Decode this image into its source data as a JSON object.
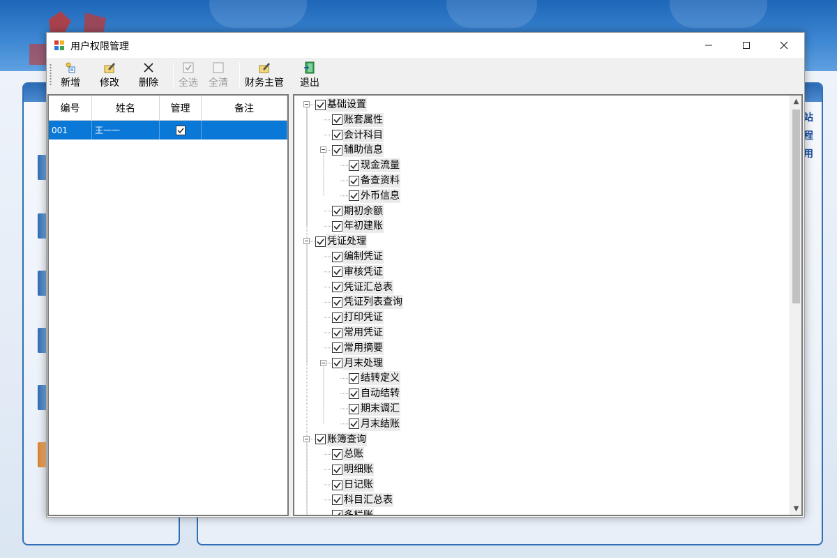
{
  "window": {
    "title": "用户权限管理",
    "controls": {
      "minimize": "─",
      "maximize": "☐",
      "close": "✕"
    }
  },
  "toolbar": {
    "add": "新增",
    "edit": "修改",
    "delete": "删除",
    "select_all": "全选",
    "clear_all": "全清",
    "finance_supervisor": "财务主管",
    "exit": "退出"
  },
  "users_grid": {
    "columns": [
      "编号",
      "姓名",
      "管理",
      "备注"
    ],
    "rows": [
      {
        "id": "001",
        "name": "王一一",
        "is_admin": true,
        "note": ""
      }
    ]
  },
  "permissions_tree": [
    {
      "label": "基础设置",
      "checked": true
    },
    {
      "label": "账套属性",
      "checked": true
    },
    {
      "label": "会计科目",
      "checked": true
    },
    {
      "label": "辅助信息",
      "checked": true
    },
    {
      "label": "现金流量",
      "checked": true
    },
    {
      "label": "备查资料",
      "checked": true
    },
    {
      "label": "外币信息",
      "checked": true
    },
    {
      "label": "期初余额",
      "checked": true
    },
    {
      "label": "年初建账",
      "checked": true
    },
    {
      "label": "凭证处理",
      "checked": true
    },
    {
      "label": "编制凭证",
      "checked": true
    },
    {
      "label": "审核凭证",
      "checked": true
    },
    {
      "label": "凭证汇总表",
      "checked": true
    },
    {
      "label": "凭证列表查询",
      "checked": true
    },
    {
      "label": "打印凭证",
      "checked": true
    },
    {
      "label": "常用凭证",
      "checked": true
    },
    {
      "label": "常用摘要",
      "checked": true
    },
    {
      "label": "月末处理",
      "checked": true
    },
    {
      "label": "结转定义",
      "checked": true
    },
    {
      "label": "自动结转",
      "checked": true
    },
    {
      "label": "期末调汇",
      "checked": true
    },
    {
      "label": "月末结账",
      "checked": true
    },
    {
      "label": "账簿查询",
      "checked": true
    },
    {
      "label": "总账",
      "checked": true
    },
    {
      "label": "明细账",
      "checked": true
    },
    {
      "label": "日记账",
      "checked": true
    },
    {
      "label": "科目汇总表",
      "checked": true
    },
    {
      "label": "多栏账",
      "checked": true
    }
  ],
  "background": {
    "side_chars": [
      "站",
      "程",
      "用"
    ]
  },
  "colors": {
    "selection": "#0a78d7",
    "header_blue": "#1e66b8"
  }
}
